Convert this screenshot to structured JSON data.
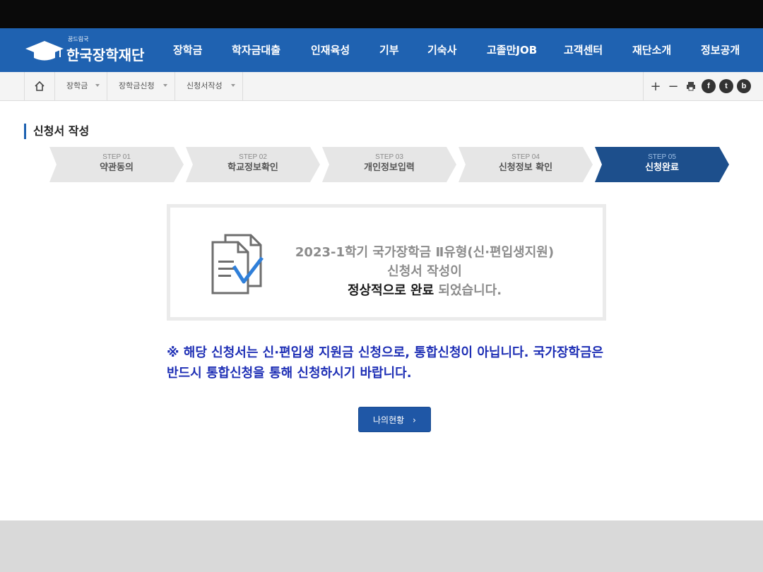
{
  "header": {
    "logo_small": "꿈드림국",
    "logo_text": "한국장학재단",
    "menu": [
      {
        "label": "장학금"
      },
      {
        "label": "학자금대출"
      },
      {
        "label": "인재육성"
      },
      {
        "label": "기부"
      },
      {
        "label": "기숙사"
      },
      {
        "label": "고졸만JOB"
      },
      {
        "label": "고객센터"
      },
      {
        "label": "재단소개"
      },
      {
        "label": "정보공개"
      }
    ]
  },
  "breadcrumb": {
    "items": [
      {
        "label": "장학금"
      },
      {
        "label": "장학금신청"
      },
      {
        "label": "신청서작성"
      }
    ],
    "tools": {
      "zoom_in": "+",
      "zoom_out": "−",
      "facebook": "f",
      "twitter": "t",
      "blog": "b"
    }
  },
  "page": {
    "title": "신청서 작성"
  },
  "steps": [
    {
      "num": "STEP 01",
      "name": "약관동의"
    },
    {
      "num": "STEP 02",
      "name": "학교정보확인"
    },
    {
      "num": "STEP 03",
      "name": "개인정보입력"
    },
    {
      "num": "STEP 04",
      "name": "신청정보 확인"
    },
    {
      "num": "STEP 05",
      "name": "신청완료"
    }
  ],
  "result": {
    "line1": "2023-1학기 국가장학금 Ⅱ유형(신·편입생지원)",
    "line2": "신청서 작성이",
    "line3_strong": "정상적으로 완료",
    "line3_rest": " 되었습니다."
  },
  "notice": {
    "text": "※ 해당 신청서는 신·편입생 지원금 신청으로, 통합신청이 아닙니다. 국가장학금은 반드시 통합신청을 통해 신청하시기 바랍니다."
  },
  "button": {
    "label": "나의현황",
    "arrow": "›"
  },
  "colors": {
    "brand_blue": "#1f62b1",
    "active_step": "#1d4f8c",
    "notice_blue": "#1e2fb5"
  }
}
